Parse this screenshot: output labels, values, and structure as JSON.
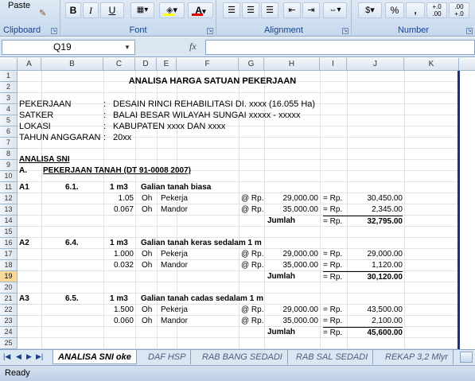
{
  "ribbon": {
    "clipboard": {
      "paste_label": "Paste",
      "group_label": "Clipboard"
    },
    "font": {
      "group_label": "Font",
      "bold": "B",
      "italic": "I",
      "underline": "U"
    },
    "alignment": {
      "group_label": "Alignment"
    },
    "number": {
      "group_label": "Number",
      "percent": "%",
      "comma": ",",
      "inc_decimal": "+.0 .00",
      "dec_decimal": ".00 +.0"
    }
  },
  "formula_bar": {
    "name_box": "Q19",
    "fx": "fx",
    "content": ""
  },
  "columns": [
    "A",
    "B",
    "C",
    "D",
    "E",
    "F",
    "G",
    "H",
    "I",
    "J",
    "K"
  ],
  "rows": [
    "1",
    "2",
    "3",
    "4",
    "5",
    "6",
    "7",
    "8",
    "9",
    "10",
    "11",
    "12",
    "13",
    "14",
    "15",
    "16",
    "17",
    "18",
    "19",
    "20",
    "21",
    "22",
    "23",
    "24",
    "25"
  ],
  "selected_row": "19",
  "sheet": {
    "title": "ANALISA HARGA SATUAN PEKERJAAN",
    "info": [
      {
        "label": "PEKERJAAN",
        "sep": ":",
        "value": "DESAIN RINCI REHABILITASI DI. xxxx (16.055 Ha)"
      },
      {
        "label": "SATKER",
        "sep": ":",
        "value": "BALAI BESAR WILAYAH SUNGAI xxxxx - xxxxx"
      },
      {
        "label": "LOKASI",
        "sep": ":",
        "value": "KABUPATEN xxxx DAN xxxx"
      },
      {
        "label": "TAHUN ANGGARAN",
        "sep": ":",
        "value": "20xx"
      }
    ],
    "analisa_label": "ANALISA SNI",
    "section_code": "A.",
    "section_title": "PEKERJAAN TANAH (DT 91-0008 2007)",
    "items": [
      {
        "code": "A1",
        "ref": "6.1.",
        "unit": "1 m3",
        "desc": "Galian tanah biasa",
        "lines": [
          {
            "coef": "1.05",
            "unit": "Oh",
            "name": "Pekerja",
            "at": "@ Rp.",
            "price": "29,000.00",
            "eq": "= Rp.",
            "total": "30,450.00"
          },
          {
            "coef": "0.067",
            "unit": "Oh",
            "name": "Mandor",
            "at": "@ Rp.",
            "price": "35,000.00",
            "eq": "= Rp.",
            "total": "2,345.00"
          }
        ],
        "sum_label": "Jumlah",
        "sum_eq": "= Rp.",
        "sum": "32,795.00"
      },
      {
        "code": "A2",
        "ref": "6.4.",
        "unit": "1 m3",
        "desc": "Galian tanah keras sedalam 1 m",
        "lines": [
          {
            "coef": "1.000",
            "unit": "Oh",
            "name": "Pekerja",
            "at": "@ Rp.",
            "price": "29,000.00",
            "eq": "= Rp.",
            "total": "29,000.00"
          },
          {
            "coef": "0.032",
            "unit": "Oh",
            "name": "Mandor",
            "at": "@ Rp.",
            "price": "35,000.00",
            "eq": "= Rp.",
            "total": "1,120.00"
          }
        ],
        "sum_label": "Jumlah",
        "sum_eq": "= Rp.",
        "sum": "30,120.00"
      },
      {
        "code": "A3",
        "ref": "6.5.",
        "unit": "1 m3",
        "desc": "Galian tanah cadas sedalam 1 m",
        "lines": [
          {
            "coef": "1.500",
            "unit": "Oh",
            "name": "Pekerja",
            "at": "@ Rp.",
            "price": "29,000.00",
            "eq": "= Rp.",
            "total": "43,500.00"
          },
          {
            "coef": "0.060",
            "unit": "Oh",
            "name": "Mandor",
            "at": "@ Rp.",
            "price": "35,000.00",
            "eq": "= Rp.",
            "total": "2,100.00"
          }
        ],
        "sum_label": "Jumlah",
        "sum_eq": "= Rp.",
        "sum": "45,600.00"
      }
    ]
  },
  "tabs": [
    {
      "label": "ANALISA SNI oke",
      "active": true
    },
    {
      "label": "DAF HSP",
      "active": false
    },
    {
      "label": "RAB BANG SEDADI",
      "active": false
    },
    {
      "label": "RAB SAL SEDADI",
      "active": false
    },
    {
      "label": "REKAP 3,2 Mlyr",
      "active": false
    }
  ],
  "status": {
    "text": "Ready"
  },
  "colors": {
    "accent": "#15428b",
    "selected_row": "#f9d99a",
    "border_blue": "#1a2f8a"
  }
}
